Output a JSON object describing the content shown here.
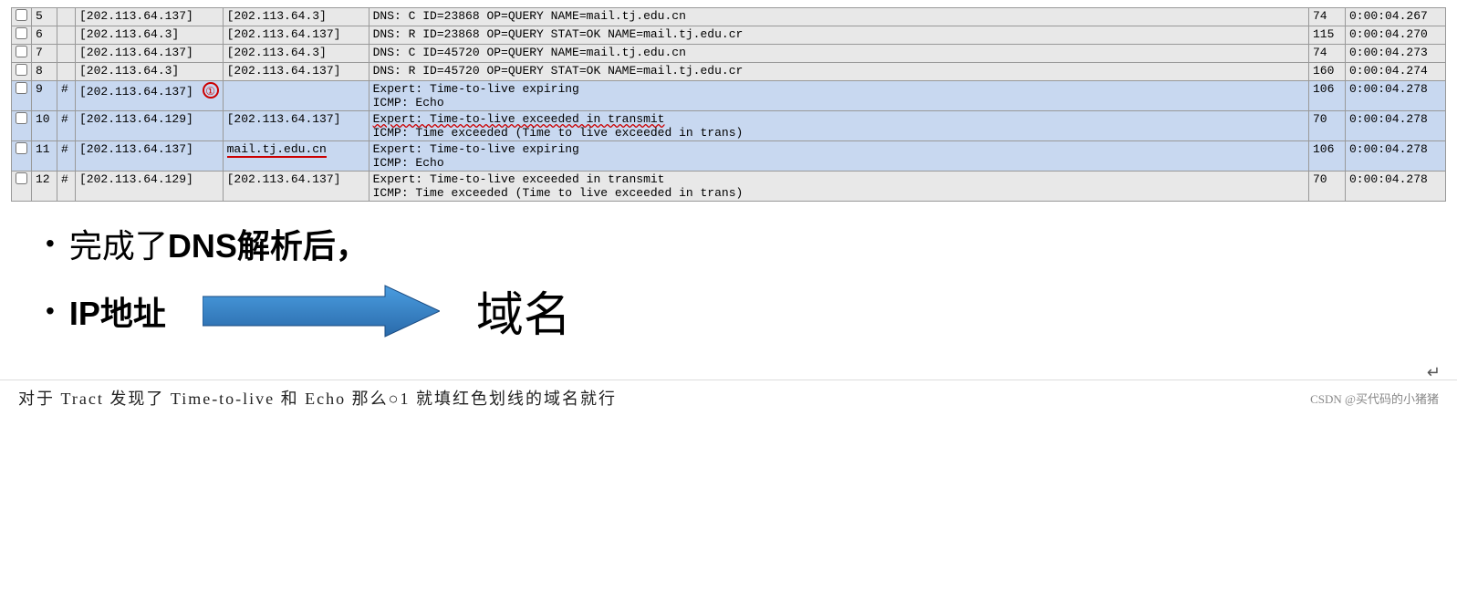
{
  "table": {
    "rows": [
      {
        "check": "",
        "num": "5",
        "mark": "",
        "src": "[202.113.64.137]",
        "dst": "[202.113.64.3]",
        "info": "DNS: C ID=23868 OP=QUERY NAME=mail.tj.edu.cn",
        "len": "74",
        "time": "0:00:04.267",
        "highlight": false
      },
      {
        "check": "",
        "num": "6",
        "mark": "",
        "src": "[202.113.64.3]",
        "dst": "[202.113.64.137]",
        "info": "DNS: R ID=23868 OP=QUERY STAT=OK NAME=mail.tj.edu.cr",
        "len": "115",
        "time": "0:00:04.270",
        "highlight": false
      },
      {
        "check": "",
        "num": "7",
        "mark": "",
        "src": "[202.113.64.137]",
        "dst": "[202.113.64.3]",
        "info": "DNS: C ID=45720 OP=QUERY NAME=mail.tj.edu.cn",
        "len": "74",
        "time": "0:00:04.273",
        "highlight": false
      },
      {
        "check": "",
        "num": "8",
        "mark": "",
        "src": "[202.113.64.3]",
        "dst": "[202.113.64.137]",
        "info": "DNS: R ID=45720 OP=QUERY STAT=OK NAME=mail.tj.edu.cr",
        "len": "160",
        "time": "0:00:04.274",
        "highlight": false
      },
      {
        "check": "",
        "num": "9",
        "mark": "#",
        "src": "[202.113.64.137]",
        "dst": "",
        "info": "Expert: Time-to-live expiring",
        "info2": "ICMP: Echo",
        "len": "106",
        "time": "0:00:04.278",
        "highlight": true
      },
      {
        "check": "",
        "num": "10",
        "mark": "#",
        "src": "[202.113.64.129]",
        "dst": "[202.113.64.137]",
        "info": "Expert: Time-to-live exceeded in transmit",
        "info2": "ICMP: Time exceeded (Time to live exceeded in trans)",
        "len": "70",
        "time": "0:00:04.278",
        "highlight": true
      },
      {
        "check": "",
        "num": "11",
        "mark": "#",
        "src": "[202.113.64.137]",
        "dst": "mail.tj.edu.cn",
        "info": "Expert: Time-to-live expiring",
        "info2": "ICMP: Echo",
        "len": "106",
        "time": "0:00:04.278",
        "highlight": true
      },
      {
        "check": "",
        "num": "12",
        "mark": "#",
        "src": "[202.113.64.129]",
        "dst": "[202.113.64.137]",
        "info": "Expert: Time-to-live exceeded in transmit",
        "info2": "ICMP: Time exceeded (Time to live exceeded in trans)",
        "len": "70",
        "time": "0:00:04.278",
        "highlight": false
      }
    ]
  },
  "bullets": {
    "item1": {
      "bullet": "•",
      "text_normal": "完成了",
      "text_bold": "DNS解析后，"
    },
    "item2": {
      "bullet": "•",
      "text_bold": "IP地址",
      "text_domain": "域名"
    }
  },
  "bottom": {
    "text": "对于 Tract 发现了 Time-to-live 和 Echo 那么○1 就填红色划线的域名就行",
    "watermark": "CSDN @买代码的小猪猪"
  },
  "arrow": {
    "color": "#3a7fc1",
    "shadow": "#1a4a80"
  }
}
